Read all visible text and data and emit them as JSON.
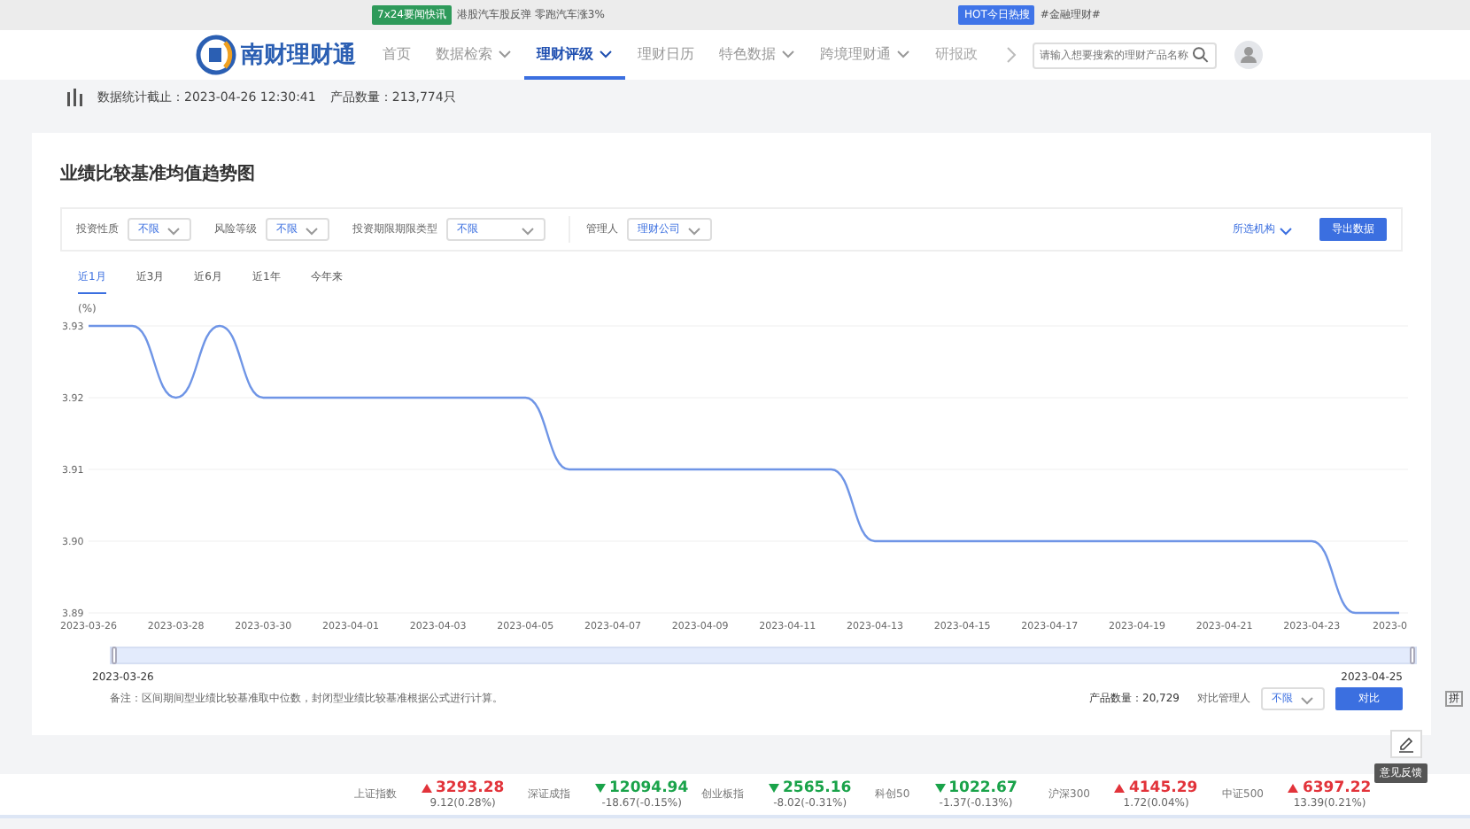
{
  "banner": [
    {
      "badge": "7x24要闻快讯",
      "text": "港股汽车股反弹 零跑汽车涨3%"
    },
    {
      "badge": "HOT今日热搜",
      "text": "#金融理财#"
    }
  ],
  "nav": {
    "logo": "南财理财通",
    "items": [
      {
        "label": "首页",
        "caret": false,
        "selected": false
      },
      {
        "label": "数据检索",
        "caret": true,
        "selected": false
      },
      {
        "label": "理财评级",
        "caret": true,
        "selected": true
      },
      {
        "label": "理财日历",
        "caret": false,
        "selected": false
      },
      {
        "label": "特色数据",
        "caret": true,
        "selected": false
      },
      {
        "label": "跨境理财通",
        "caret": true,
        "selected": false
      },
      {
        "label": "研报政",
        "caret": false,
        "selected": false
      }
    ],
    "search": {
      "placeholder": "请输入想要搜索的理财产品名称"
    }
  },
  "stats": {
    "updated": "数据统计截止：2023-04-26 12:30:41",
    "count": "产品数量：213,774只"
  },
  "card": {
    "title": "业绩比较基准均值趋势图",
    "filters": [
      {
        "label": "投资性质",
        "value": "不限",
        "wide": false
      },
      {
        "label": "风险等级",
        "value": "不限",
        "wide": false
      },
      {
        "label": "投资期限期限类型",
        "value": "不限",
        "wide": true
      },
      {
        "label": "管理人",
        "value": "理财公司",
        "wide": false
      }
    ],
    "institution": "所选机构",
    "export": "导出数据",
    "tabs": [
      {
        "label": "近1月",
        "selected": true
      },
      {
        "label": "近3月",
        "selected": false
      },
      {
        "label": "近6月",
        "selected": false
      },
      {
        "label": "近1年",
        "selected": false
      },
      {
        "label": "今年来",
        "selected": false
      }
    ],
    "chart_data": {
      "type": "line",
      "ylabel": "(%)",
      "grid": true,
      "categories": [
        "2023-03-26",
        null,
        "2023-03-28",
        null,
        "2023-03-30",
        null,
        "2023-04-01",
        null,
        "2023-04-03",
        null,
        "2023-04-05",
        null,
        "2023-04-07",
        null,
        "2023-04-09",
        null,
        "2023-04-11",
        null,
        "2023-04-13",
        null,
        "2023-04-15",
        null,
        "2023-04-17",
        null,
        "2023-04-19",
        null,
        "2023-04-21",
        null,
        "2023-04-23",
        null,
        "2023-0"
      ],
      "series": [
        {
          "color": "#6f95e6",
          "values": [
            3.93,
            3.93,
            3.92,
            3.93,
            3.92,
            3.92,
            3.92,
            3.92,
            3.92,
            3.92,
            3.92,
            3.91,
            3.91,
            3.91,
            3.91,
            3.91,
            3.91,
            3.91,
            3.9,
            3.9,
            3.9,
            3.9,
            3.9,
            3.9,
            3.9,
            3.9,
            3.9,
            3.9,
            3.9,
            3.89,
            3.89
          ]
        }
      ],
      "ylim": [
        3.89,
        3.93
      ],
      "yticks": [
        {
          "value": 3.89,
          "label": "3.89"
        },
        {
          "value": 3.9,
          "label": "3.90"
        },
        {
          "value": 3.91,
          "label": "3.91"
        },
        {
          "value": 3.92,
          "label": "3.92"
        },
        {
          "value": 3.93,
          "label": "3.93"
        }
      ]
    },
    "zoom": {
      "start": "2023-03-26",
      "end": "2023-04-25",
      "level": 1
    },
    "note": "备注：区间期间型业绩比较基准取中位数，封闭型业绩比较基准根据公式进行计算。",
    "product_count": "产品数量：20,729",
    "compare_label": "对比管理人",
    "compare_value": "不限",
    "compare_button": "对比"
  },
  "feedback": "意见反馈",
  "side_strip": "拼",
  "ticker": [
    {
      "name": "上证指数",
      "value": "3293.28",
      "change": "9.12(0.28%)",
      "up": true
    },
    {
      "name": "深证成指",
      "value": "12094.94",
      "change": "-18.67(-0.15%)",
      "up": false
    },
    {
      "name": "创业板指",
      "value": "2565.16",
      "change": "-8.02(-0.31%)",
      "up": false
    },
    {
      "name": "科创50",
      "value": "1022.67",
      "change": "-1.37(-0.13%)",
      "up": false
    },
    {
      "name": "沪深300",
      "value": "4145.29",
      "change": "1.72(0.04%)",
      "up": true
    },
    {
      "name": "中证500",
      "value": "6397.22",
      "change": "13.39(0.21%)",
      "up": true
    }
  ]
}
